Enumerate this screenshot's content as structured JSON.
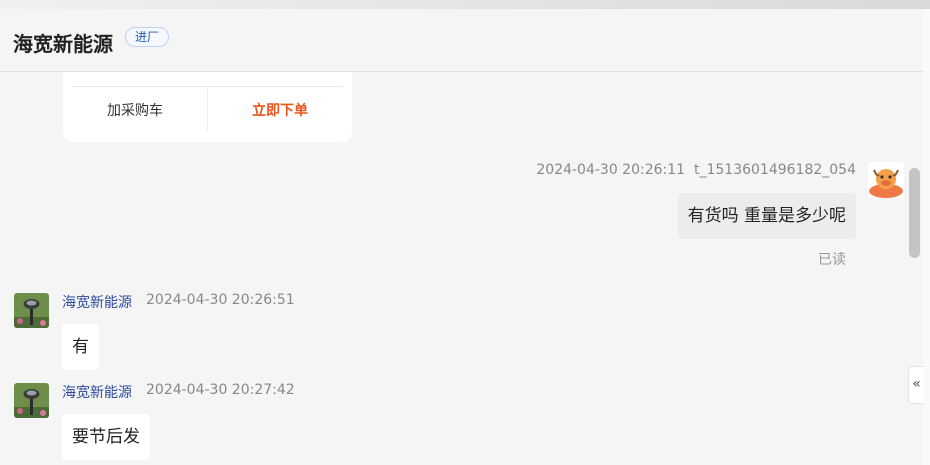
{
  "header": {
    "title": "海宽新能源",
    "badge": "进厂"
  },
  "product_card": {
    "add_cart_label": "加采购车",
    "buy_now_label": "立即下单"
  },
  "messages": [
    {
      "timestamp": "2024-04-30 20:26:11",
      "sender": "t_1513601496182_054",
      "text": "有货吗 重量是多少呢",
      "status": "已读"
    },
    {
      "sender": "海宽新能源",
      "timestamp": "2024-04-30 20:26:51",
      "text": "有"
    },
    {
      "sender": "海宽新能源",
      "timestamp": "2024-04-30 20:27:42",
      "text": "要节后发"
    }
  ],
  "collapse_glyph": "«",
  "colors": {
    "accent_buy": "#e8541b",
    "sender_name": "#2b4a9b",
    "badge": "#1f5bb5"
  }
}
